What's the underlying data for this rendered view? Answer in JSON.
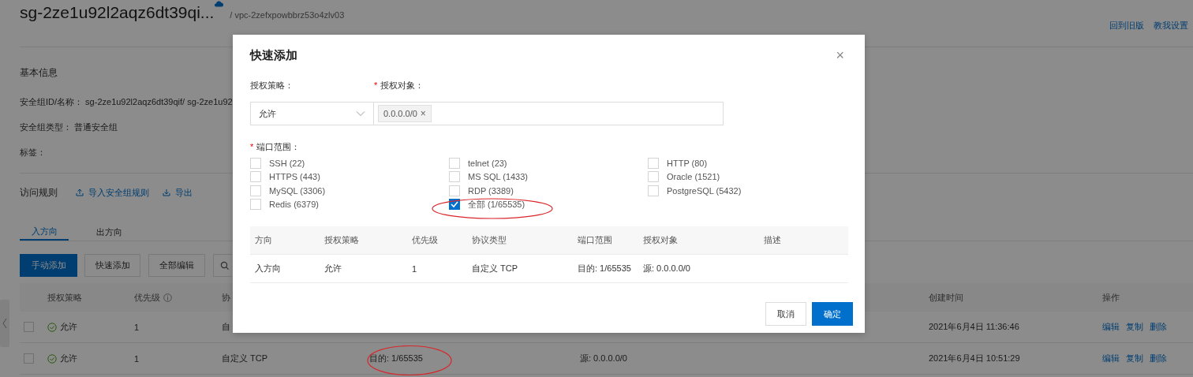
{
  "header": {
    "title": "sg-2ze1u92l2aqz6dt39qi...",
    "vpc": "/ vpc-2zefxpowbbrz53o4zlv03",
    "links": [
      "回到旧版",
      "教我设置"
    ]
  },
  "basic_info": {
    "heading": "基本信息",
    "fields": [
      {
        "label": "安全组ID/名称：",
        "value": "sg-2ze1u92l2aqz6dt39qif/ sg-2ze1u92"
      },
      {
        "label": "安全组类型：",
        "value": "普通安全组"
      },
      {
        "label": "标签："
      }
    ]
  },
  "rules": {
    "heading": "访问规则",
    "actions": [
      {
        "kind": "import",
        "label": "导入安全组规则"
      },
      {
        "kind": "export",
        "label": "导出"
      }
    ],
    "tabs": [
      {
        "label": "入方向",
        "selected": true
      },
      {
        "label": "出方向",
        "selected": false
      }
    ],
    "buttons": [
      {
        "label": "手动添加",
        "primary": true
      },
      {
        "label": "快速添加",
        "primary": false
      },
      {
        "label": "全部编辑",
        "primary": false
      }
    ],
    "table": {
      "columns": {
        "policy": "授权策略",
        "priority": "优先级",
        "protocol": "协",
        "time": "创建时间",
        "actions": "操作"
      },
      "rows": [
        {
          "checked": false,
          "policy": "允许",
          "priority": "1",
          "protocol": "自",
          "time": "2021年6月4日 11:36:46",
          "actions": [
            "编辑",
            "复制",
            "删除"
          ]
        },
        {
          "checked": false,
          "policy": "允许",
          "priority": "1",
          "protocol": "自定义 TCP",
          "port": "目的: 1/65535",
          "object": "源: 0.0.0.0/0",
          "time": "2021年6月4日 10:51:29",
          "actions": [
            "编辑",
            "复制",
            "删除"
          ]
        }
      ]
    }
  },
  "modal": {
    "title": "快速添加",
    "close": "×",
    "policy": {
      "label": "授权策略：",
      "value": "允许"
    },
    "object": {
      "label": "授权对象：",
      "required_mark": "*",
      "tags": [
        {
          "label": "0.0.0.0/0",
          "remove": "×"
        }
      ]
    },
    "ports": {
      "label": "端口范围：",
      "required_mark": "*",
      "options": [
        {
          "label": "SSH (22)",
          "checked": false
        },
        {
          "label": "telnet (23)",
          "checked": false
        },
        {
          "label": "HTTP (80)",
          "checked": false
        },
        {
          "label": "HTTPS (443)",
          "checked": false
        },
        {
          "label": "MS SQL (1433)",
          "checked": false
        },
        {
          "label": "Oracle (1521)",
          "checked": false
        },
        {
          "label": "MySQL (3306)",
          "checked": false
        },
        {
          "label": "RDP (3389)",
          "checked": false
        },
        {
          "label": "PostgreSQL (5432)",
          "checked": false
        },
        {
          "label": "Redis (6379)",
          "checked": false
        },
        {
          "label": "全部 (1/65535)",
          "checked": true
        }
      ]
    },
    "preview": {
      "columns": [
        "方向",
        "授权策略",
        "优先级",
        "协议类型",
        "端口范围",
        "授权对象",
        "描述"
      ],
      "rows": [
        [
          "入方向",
          "允许",
          "1",
          "自定义 TCP",
          "目的: 1/65535",
          "源: 0.0.0.0/0"
        ]
      ]
    },
    "buttons": [
      {
        "label": "取消",
        "primary": false
      },
      {
        "label": "确定",
        "primary": true
      }
    ]
  }
}
